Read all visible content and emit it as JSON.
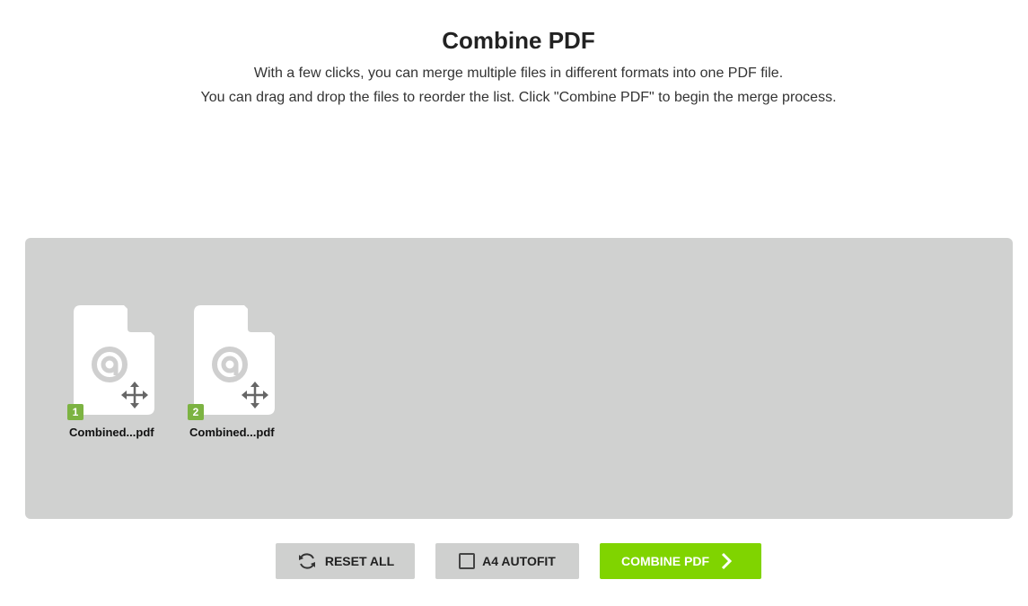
{
  "header": {
    "title": "Combine PDF",
    "line1": "With a few clicks, you can merge multiple files in different formats into one PDF file.",
    "line2": "You can drag and drop the files to reorder the list. Click \"Combine PDF\" to begin the merge process."
  },
  "files": [
    {
      "index": "1",
      "name": "Combined...pdf",
      "icon": "file-pdf-icon"
    },
    {
      "index": "2",
      "name": "Combined...pdf",
      "icon": "file-pdf-icon"
    }
  ],
  "actions": {
    "reset_label": "RESET ALL",
    "autofit_label": "A4 AUTOFIT",
    "combine_label": "COMBINE PDF"
  },
  "colors": {
    "accent": "#80d400",
    "index_badge": "#7cb342",
    "dropzone": "#d0d1d0",
    "button_gray": "#cfd0cf"
  }
}
